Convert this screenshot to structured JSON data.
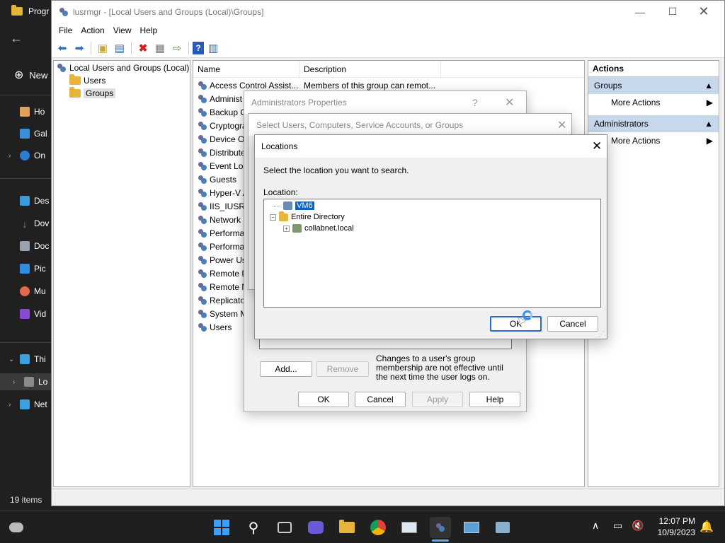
{
  "explorer": {
    "title": "Progr",
    "new_label": "New",
    "nav_items": [
      "Ho",
      "Gal",
      "On",
      "Des",
      "Dov",
      "Doc",
      "Pic",
      "Mu",
      "Vid",
      "Thi",
      "Lo",
      "Net"
    ],
    "status": "19 items"
  },
  "mmc": {
    "title": "lusrmgr - [Local Users and Groups (Local)\\Groups]",
    "menu": [
      "File",
      "Action",
      "View",
      "Help"
    ],
    "tree": {
      "root": "Local Users and Groups (Local)",
      "users": "Users",
      "groups": "Groups"
    },
    "columns": {
      "name": "Name",
      "description": "Description"
    },
    "groups": [
      "Access Control Assist...",
      "Administ",
      "Backup O",
      "Cryptogra",
      "Device Ov",
      "Distribute",
      "Event Log",
      "Guests",
      "Hyper-V A",
      "IIS_IUSRS",
      "Network C",
      "Performa",
      "Performa",
      "Power Us",
      "Remote D",
      "Remote M",
      "Replicato",
      "System M",
      "Users"
    ],
    "first_description": "Members of this group can remot...",
    "actions": {
      "header": "Actions",
      "sec1": "Groups",
      "sec1_item": "More Actions",
      "sec2": "Administrators",
      "sec2_item": "More Actions"
    }
  },
  "admin_dialog": {
    "title": "Administrators Properties",
    "help_glyph": "?",
    "add": "Add...",
    "remove": "Remove",
    "note": "Changes to a user's group membership are not effective until the next time the user logs on.",
    "ok": "OK",
    "cancel": "Cancel",
    "apply": "Apply",
    "help": "Help"
  },
  "select_dialog": {
    "title": "Select Users, Computers, Service Accounts, or Groups"
  },
  "locations_dialog": {
    "title": "Locations",
    "prompt": "Select the location you want to search.",
    "location_label": "Location:",
    "tree": [
      "VM6",
      "Entire Directory",
      "collabnet.local"
    ],
    "ok": "OK",
    "cancel": "Cancel"
  },
  "taskbar": {
    "time": "12:07 PM",
    "date": "10/9/2023"
  }
}
